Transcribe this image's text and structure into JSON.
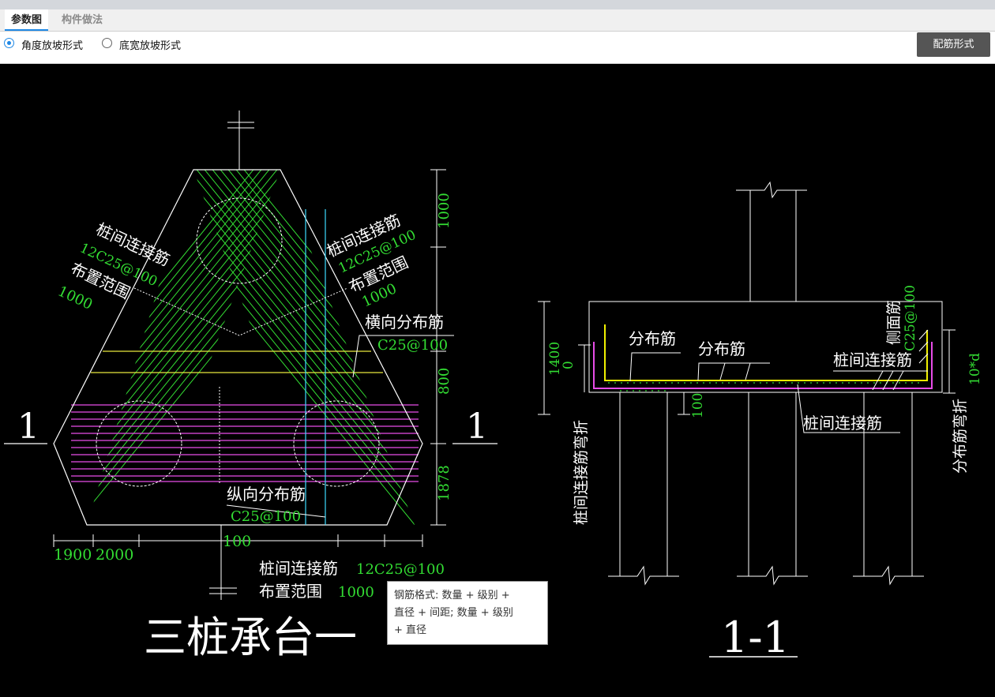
{
  "tabs": {
    "params": "参数图",
    "method": "构件做法"
  },
  "options": {
    "angle": "角度放坡形式",
    "width": "底宽放坡形式",
    "selected": "angle"
  },
  "rebar_button": "配筋形式",
  "plan": {
    "title": "三桩承台一",
    "section_mark": "1",
    "left_label": {
      "name": "桩间连接筋",
      "value": "12C25@100",
      "range": "布置范围",
      "range_value": "1000"
    },
    "right_label": {
      "name": "桩间连接筋",
      "value": "12C25@100",
      "range": "布置范围",
      "range_value": "1000"
    },
    "bottom_label": {
      "name": "桩间连接筋",
      "value": "12C25@100",
      "range": "布置范围",
      "range_value": "1000"
    },
    "horizontal": {
      "name": "横向分布筋",
      "value": "C25@100"
    },
    "vertical": {
      "name": "纵向分布筋",
      "value": "C25@100"
    },
    "dims": {
      "right": [
        "1000",
        "800",
        "1878"
      ],
      "bottom": [
        "1900",
        "2000",
        "100"
      ]
    }
  },
  "section": {
    "title": "1-1",
    "labels": {
      "dist1": "分布筋",
      "dist2": "分布筋",
      "pile_conn": "桩间连接筋",
      "pile_conn2": "桩间连接筋",
      "side": "侧面筋",
      "side_value": "C25@100",
      "bend_left": "桩间连接筋弯折",
      "bend_right": "分布筋弯折",
      "left_dims": [
        "1400",
        "0"
      ],
      "mid_dim": "100",
      "right_dim": "10*d"
    }
  },
  "tooltip": {
    "line1": "钢筋格式: 数量 + 级别 +",
    "line2": "直径 + 间距; 数量 + 级别",
    "line3": "+ 直径"
  }
}
